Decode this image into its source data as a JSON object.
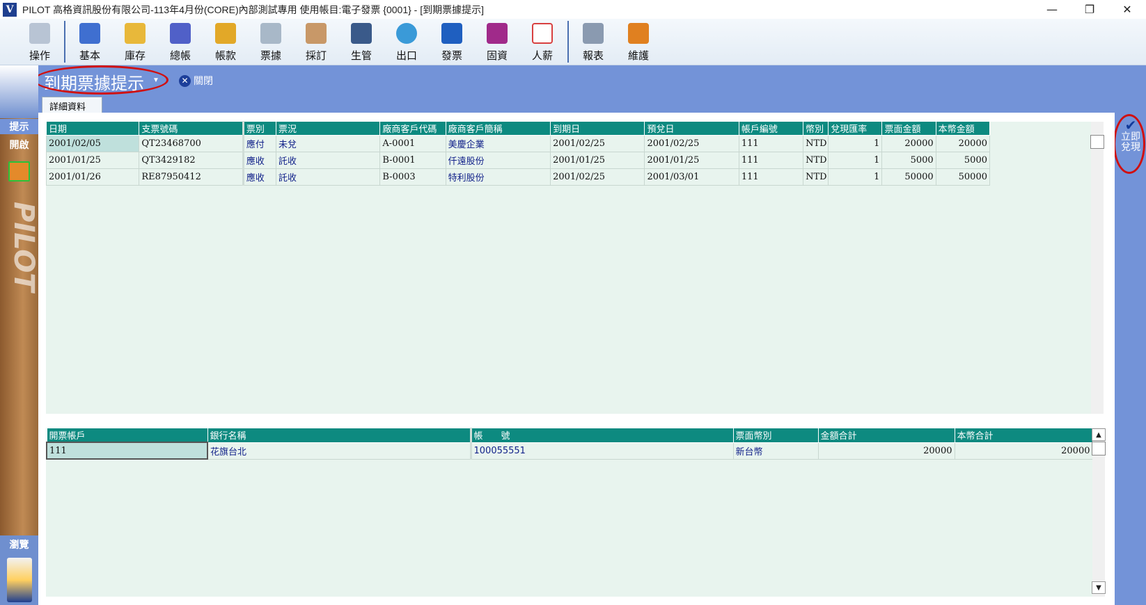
{
  "window": {
    "logo": "V",
    "title": "PILOT  高格資訊股份有限公司-113年4月份(CORE)內部測試專用 使用帳目:電子發票 {0001} - [到期票據提示]",
    "minimize": "—",
    "restore": "❐",
    "close": "✕"
  },
  "toolbar": {
    "items": [
      {
        "label": "操作",
        "icon": "mouse-icon",
        "color": "#b8c4d4"
      },
      {
        "label": "基本",
        "icon": "calendar-icon",
        "color": "#3f6fd0"
      },
      {
        "label": "庫存",
        "icon": "jar-icon",
        "color": "#e8b83a"
      },
      {
        "label": "總帳",
        "icon": "calculator-icon",
        "color": "#5060c8"
      },
      {
        "label": "帳款",
        "icon": "coins-icon",
        "color": "#e2a828"
      },
      {
        "label": "票據",
        "icon": "document-icon",
        "color": "#a8b8c8"
      },
      {
        "label": "採訂",
        "icon": "handshake-icon",
        "color": "#c89868"
      },
      {
        "label": "生管",
        "icon": "gear-monitor-icon",
        "color": "#3a5a8a"
      },
      {
        "label": "出口",
        "icon": "globe-icon",
        "color": "#3a9ad8"
      },
      {
        "label": "發票",
        "icon": "invoice-icon",
        "color": "#1f5fc0"
      },
      {
        "label": "固資",
        "icon": "stairs-icon",
        "color": "#a02a8a"
      },
      {
        "label": "人薪",
        "icon": "chart-icon",
        "color": "#d84040"
      },
      {
        "label": "報表",
        "icon": "report-icon",
        "color": "#8a9ab0"
      },
      {
        "label": "維護",
        "icon": "tools-icon",
        "color": "#e08020"
      }
    ]
  },
  "module": {
    "title": "到期票據提示",
    "close_label": "關閉",
    "detail_tab": "詳細資料"
  },
  "sidebar": {
    "hint": "提示",
    "open": "開啟",
    "brand": "PILOT",
    "browse": "瀏覽"
  },
  "right_panel": {
    "confirm_label": "立即兌現"
  },
  "upper_table": {
    "headers": [
      "日期",
      "支票號碼",
      "票別",
      "票況",
      "廠商客戶代碼",
      "廠商客戶簡稱",
      "到期日",
      "預兌日",
      "帳戶編號",
      "幣別",
      "兌現匯率",
      "票面金額",
      "本幣金額"
    ],
    "rows": [
      [
        "2001/02/05",
        "QT23468700",
        "應付",
        "未兌",
        "A-0001",
        "美慶企業",
        "2001/02/25",
        "2001/02/25",
        "111",
        "NTD",
        "1",
        "20000",
        "20000"
      ],
      [
        "2001/01/25",
        "QT3429182",
        "應收",
        "託收",
        "B-0001",
        "仟遠股份",
        "2001/01/25",
        "2001/01/25",
        "111",
        "NTD",
        "1",
        "5000",
        "5000"
      ],
      [
        "2001/01/26",
        "RE87950412",
        "應收",
        "託收",
        "B-0003",
        "特利股份",
        "2001/02/25",
        "2001/03/01",
        "111",
        "NTD",
        "1",
        "50000",
        "50000"
      ]
    ]
  },
  "lower_table": {
    "headers": [
      "開票帳戶",
      "銀行名稱",
      "帳　　號",
      "票面幣別",
      "金額合計",
      "本幣合計"
    ],
    "rows": [
      [
        "111",
        "花旗台北",
        "100055551",
        "新台幣",
        "20000",
        "20000"
      ]
    ]
  },
  "scroll": {
    "up": "▲",
    "down": "▼"
  },
  "colors": {
    "header_bg": "#0d8a80",
    "band": "#7393d8",
    "grid_bg": "#e8f4ee",
    "highlight": "#d01010"
  }
}
